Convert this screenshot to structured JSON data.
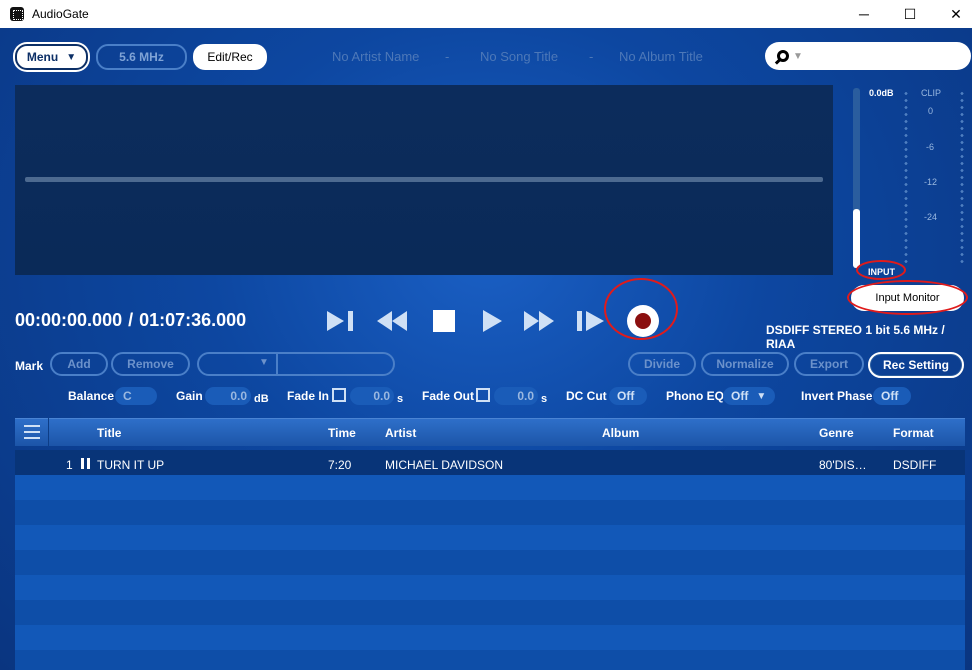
{
  "window": {
    "title": "AudioGate",
    "minimize": "─",
    "maximize": "☐",
    "close": "✕"
  },
  "toolbar": {
    "menu_label": "Menu",
    "menu_caret": "▼",
    "freq_label": "5.6 MHz",
    "edit_rec_label": "Edit/Rec"
  },
  "song_info": {
    "artist": "No Artist Name",
    "sep1": "-",
    "song": "No Song Title",
    "sep2": "-",
    "album": "No Album Title"
  },
  "search": {
    "caret": "▼",
    "placeholder": ""
  },
  "meter": {
    "db_label": "0.0dB",
    "clip_label": "CLIP",
    "scale": [
      "0",
      "-6",
      "-12",
      "-24"
    ],
    "input_label": "INPUT",
    "level": 0.33
  },
  "input_monitor_label": "Input Monitor",
  "format_text": "DSDIFF STEREO 1 bit 5.6 MHz / RIAA",
  "time": {
    "current": "00:00:00.000",
    "sep": "/",
    "total": "01:07:36.000"
  },
  "mark": {
    "label": "Mark",
    "add": "Add",
    "remove": "Remove",
    "combo_caret": "▼",
    "divide": "Divide",
    "normalize": "Normalize",
    "export": "Export",
    "rec_setting": "Rec Setting"
  },
  "controls": {
    "balance_label": "Balance",
    "balance_value": "C",
    "gain_label": "Gain",
    "gain_value": "0.0",
    "gain_unit": "dB",
    "fade_in_label": "Fade In",
    "fade_in_value": "0.0",
    "fade_in_unit": "s",
    "fade_out_label": "Fade Out",
    "fade_out_value": "0.0",
    "fade_out_unit": "s",
    "dc_cut_label": "DC Cut",
    "dc_cut_value": "Off",
    "phono_eq_label": "Phono EQ",
    "phono_eq_value": "Off",
    "phono_eq_caret": "▼",
    "invert_phase_label": "Invert Phase",
    "invert_phase_value": "Off"
  },
  "table": {
    "columns": {
      "title": "Title",
      "time": "Time",
      "artist": "Artist",
      "album": "Album",
      "genre": "Genre",
      "format": "Format"
    },
    "rows": [
      {
        "index": "1",
        "title": "TURN IT UP",
        "time": "7:20",
        "artist": "MICHAEL DAVIDSON",
        "album": "",
        "genre": "80'DIS…",
        "format": "DSDIFF"
      }
    ]
  },
  "colors": {
    "accent": "#0d47a1",
    "annotation": "#e01b1b",
    "record": "#8b0f0f"
  }
}
